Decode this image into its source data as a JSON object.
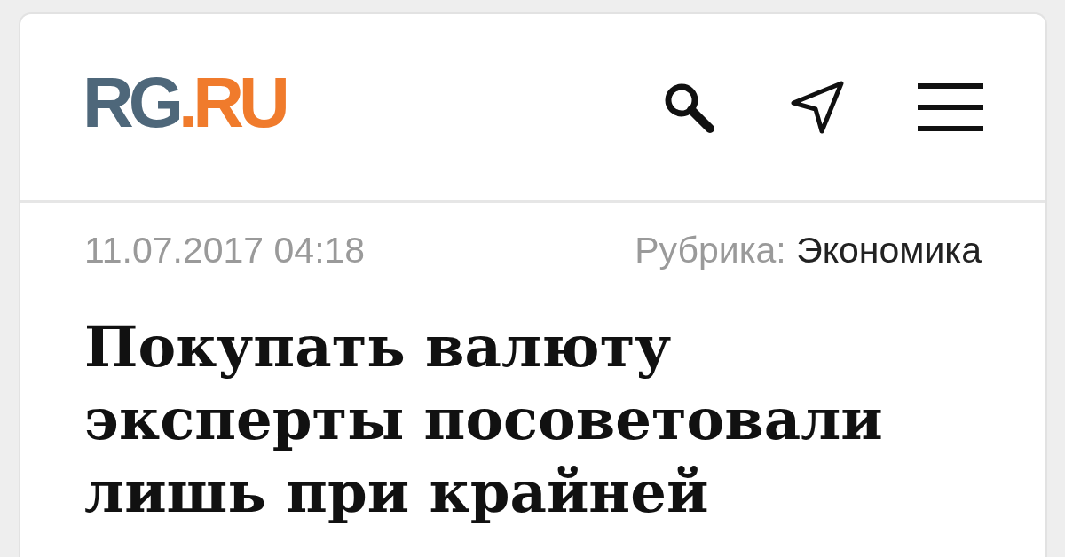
{
  "header": {
    "logo": [
      {
        "text": "RG",
        "color": "#4e677a"
      },
      {
        "text": ".RU",
        "color": "#f07b2c"
      }
    ]
  },
  "article": {
    "date": "11.07.2017 04:18",
    "rubric_label": "Рубрика:",
    "rubric": "Экономика",
    "headline": "Покупать валюту эксперты посоветовали лишь при крайней"
  }
}
